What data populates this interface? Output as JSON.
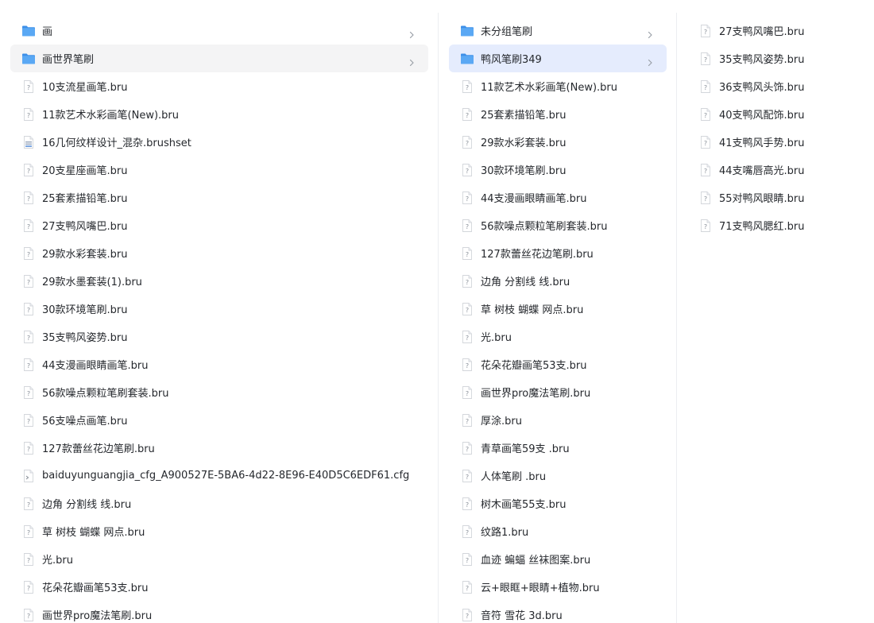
{
  "columns": [
    {
      "id": "col1",
      "items": [
        {
          "type": "folder",
          "label": "画",
          "chevron": true,
          "selected": ""
        },
        {
          "type": "folder",
          "label": "画世界笔刷",
          "chevron": true,
          "selected": "grey"
        },
        {
          "type": "file",
          "label": "10支流星画笔.bru"
        },
        {
          "type": "file",
          "label": "11款艺术水彩画笔(New).bru"
        },
        {
          "type": "brushset",
          "label": "16几何纹样设计_混杂.brushset"
        },
        {
          "type": "file",
          "label": "20支星座画笔.bru"
        },
        {
          "type": "file",
          "label": "25套素描铅笔.bru"
        },
        {
          "type": "file",
          "label": "27支鸭风嘴巴.bru"
        },
        {
          "type": "file",
          "label": "29款水彩套装.bru"
        },
        {
          "type": "file",
          "label": "29款水墨套装(1).bru"
        },
        {
          "type": "file",
          "label": "30款环境笔刷.bru"
        },
        {
          "type": "file",
          "label": "35支鸭风姿势.bru"
        },
        {
          "type": "file",
          "label": "44支漫画眼睛画笔.bru"
        },
        {
          "type": "file",
          "label": "56款噪点颗粒笔刷套装.bru"
        },
        {
          "type": "file",
          "label": "56支噪点画笔.bru"
        },
        {
          "type": "file",
          "label": "127款蕾丝花边笔刷.bru"
        },
        {
          "type": "cfg",
          "label": "baiduyunguangjia_cfg_A900527E-5BA6-4d22-8E96-E40D5C6EDF61.cfg"
        },
        {
          "type": "file",
          "label": "边角 分割线 线.bru"
        },
        {
          "type": "file",
          "label": "草 树枝 蝴蝶 网点.bru"
        },
        {
          "type": "file",
          "label": "光.bru"
        },
        {
          "type": "file",
          "label": "花朵花瓣画笔53支.bru"
        },
        {
          "type": "file",
          "label": "画世界pro魔法笔刷.bru"
        }
      ]
    },
    {
      "id": "col2",
      "items": [
        {
          "type": "folder",
          "label": "未分组笔刷",
          "chevron": true,
          "selected": ""
        },
        {
          "type": "folder",
          "label": "鸭风笔刷349",
          "chevron": true,
          "selected": "blue"
        },
        {
          "type": "file",
          "label": "11款艺术水彩画笔(New).bru"
        },
        {
          "type": "file",
          "label": "25套素描铅笔.bru"
        },
        {
          "type": "file",
          "label": "29款水彩套装.bru"
        },
        {
          "type": "file",
          "label": "30款环境笔刷.bru"
        },
        {
          "type": "file",
          "label": "44支漫画眼睛画笔.bru"
        },
        {
          "type": "file",
          "label": "56款噪点颗粒笔刷套装.bru"
        },
        {
          "type": "file",
          "label": "127款蕾丝花边笔刷.bru"
        },
        {
          "type": "file",
          "label": "边角 分割线 线.bru"
        },
        {
          "type": "file",
          "label": "草 树枝 蝴蝶 网点.bru"
        },
        {
          "type": "file",
          "label": "光.bru"
        },
        {
          "type": "file",
          "label": "花朵花瓣画笔53支.bru"
        },
        {
          "type": "file",
          "label": "画世界pro魔法笔刷.bru"
        },
        {
          "type": "file",
          "label": "厚涂.bru"
        },
        {
          "type": "file",
          "label": "青草画笔59支 .bru"
        },
        {
          "type": "file",
          "label": "人体笔刷 .bru"
        },
        {
          "type": "file",
          "label": "树木画笔55支.bru"
        },
        {
          "type": "file",
          "label": "纹路1.bru"
        },
        {
          "type": "file",
          "label": "血迹 蝙蝠 丝袜图案.bru"
        },
        {
          "type": "file",
          "label": "云+眼眶+眼睛+植物.bru"
        },
        {
          "type": "file",
          "label": "音符 雪花 3d.bru"
        }
      ]
    },
    {
      "id": "col3",
      "items": [
        {
          "type": "file",
          "label": "27支鸭风嘴巴.bru"
        },
        {
          "type": "file",
          "label": "35支鸭风姿势.bru"
        },
        {
          "type": "file",
          "label": "36支鸭风头饰.bru"
        },
        {
          "type": "file",
          "label": "40支鸭风配饰.bru"
        },
        {
          "type": "file",
          "label": "41支鸭风手势.bru"
        },
        {
          "type": "file",
          "label": "44支嘴唇高光.bru"
        },
        {
          "type": "file",
          "label": "55对鸭风眼睛.bru"
        },
        {
          "type": "file",
          "label": "71支鸭风腮红.bru"
        }
      ]
    }
  ],
  "icons": {
    "folder": "folder-icon",
    "file": "unknown-file-icon",
    "brushset": "brushset-file-icon",
    "cfg": "cfg-file-icon",
    "chevron": "chevron-right-icon"
  },
  "colors": {
    "folder": "#5aa8f4",
    "folder_tab": "#3d8fe8",
    "selected_grey": "#f4f4f5",
    "selected_blue": "#e5ecfd",
    "text": "#25282d"
  }
}
